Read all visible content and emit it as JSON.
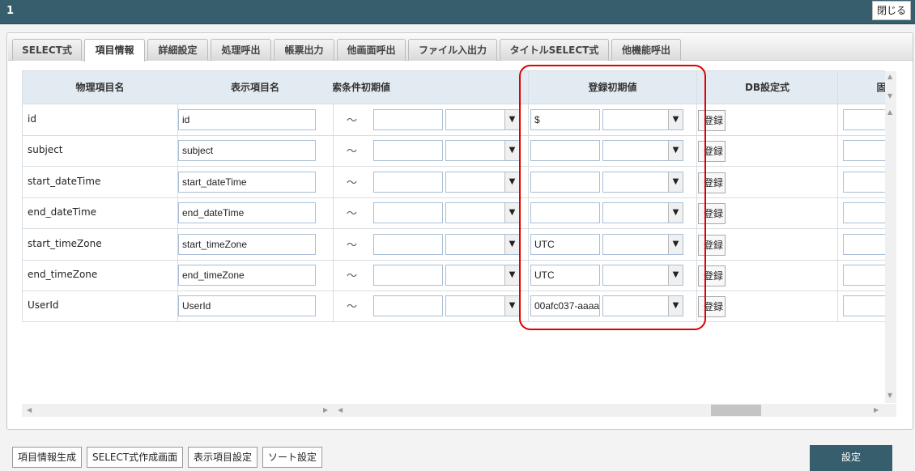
{
  "window": {
    "title": "1",
    "close_label": "閉じる"
  },
  "tabs": [
    {
      "label": "SELECT式"
    },
    {
      "label": "項目情報",
      "active": true
    },
    {
      "label": "詳細設定"
    },
    {
      "label": "処理呼出"
    },
    {
      "label": "帳票出力"
    },
    {
      "label": "他画面呼出"
    },
    {
      "label": "ファイル入出力"
    },
    {
      "label": "タイトルSELECT式"
    },
    {
      "label": "他機能呼出"
    }
  ],
  "table": {
    "headers": {
      "physical": "物理項目名",
      "display": "表示項目名",
      "search_init": "検索条件初期値",
      "reg_init": "登録初期値",
      "db_expr": "DB設定式",
      "fixed": "固定"
    },
    "tilde": "〜",
    "reg_button": "登録",
    "rows": [
      {
        "physical": "id",
        "display": "id",
        "reg_value": "$"
      },
      {
        "physical": "subject",
        "display": "subject",
        "reg_value": ""
      },
      {
        "physical": "start_dateTime",
        "display": "start_dateTime",
        "reg_value": ""
      },
      {
        "physical": "end_dateTime",
        "display": "end_dateTime",
        "reg_value": ""
      },
      {
        "physical": "start_timeZone",
        "display": "start_timeZone",
        "reg_value": "UTC"
      },
      {
        "physical": "end_timeZone",
        "display": "end_timeZone",
        "reg_value": "UTC"
      },
      {
        "physical": "UserId",
        "display": "UserId",
        "reg_value": "00afc037-aaaa"
      }
    ]
  },
  "highlight_color": "#e00000",
  "footer": {
    "buttons": [
      "項目情報生成",
      "SELECT式作成画面",
      "表示項目設定",
      "ソート設定"
    ],
    "ok_label": "設定"
  }
}
